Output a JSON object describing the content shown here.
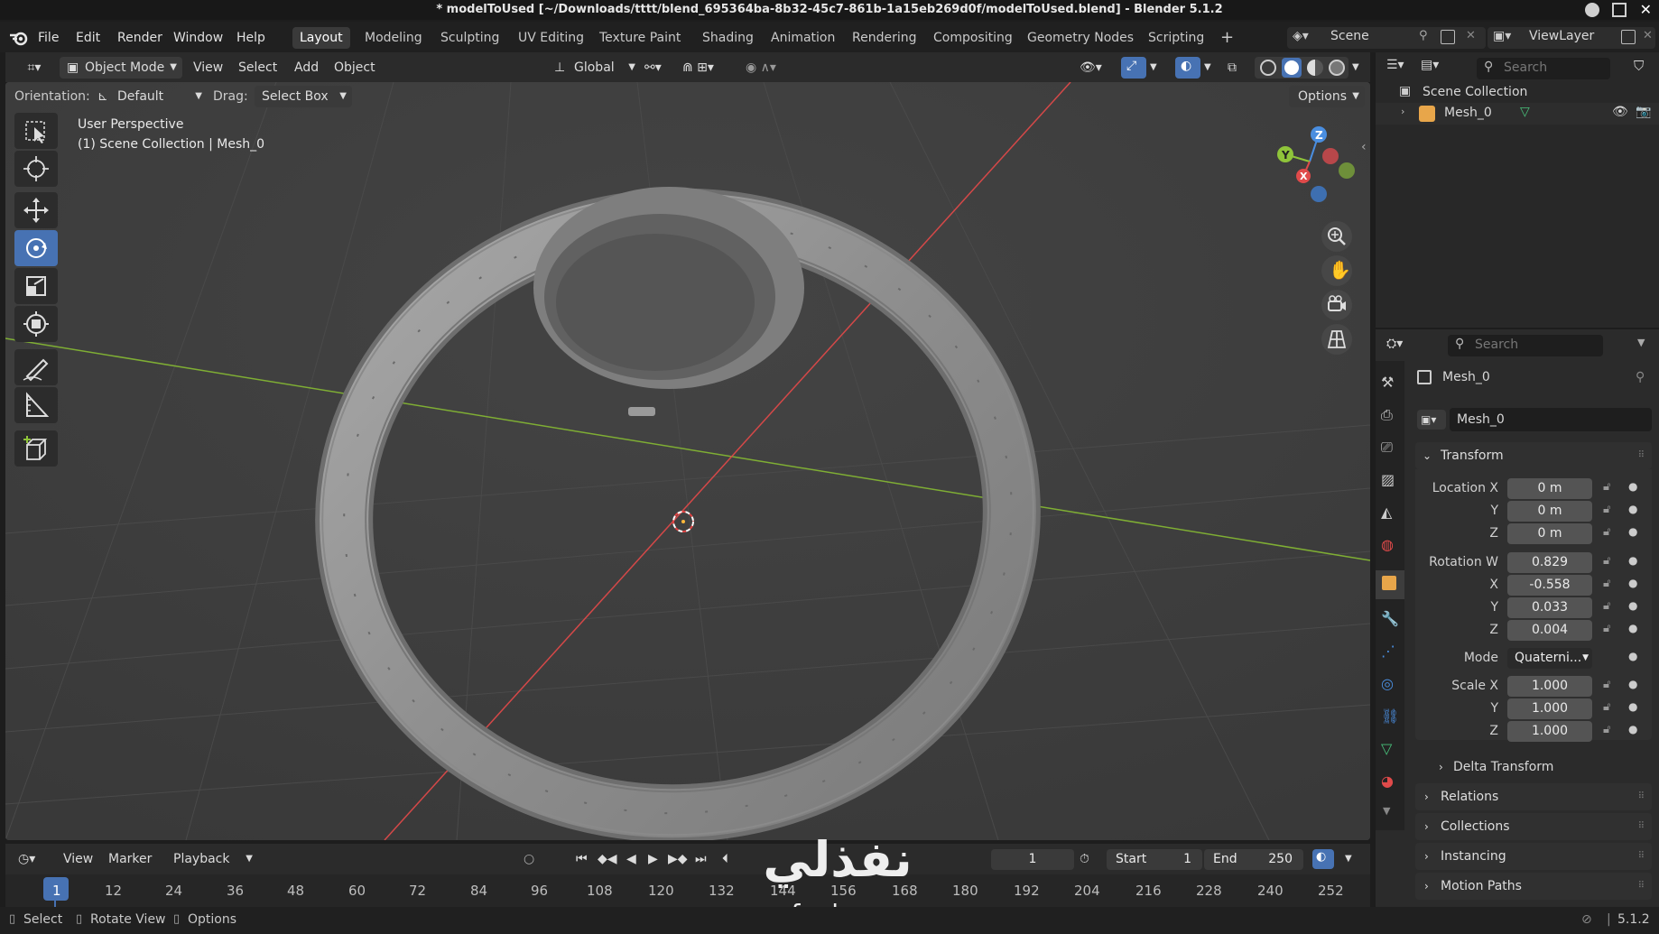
{
  "window": {
    "title": "* modelToUsed [~/Downloads/tttt/blend_695364ba-8b32-45c7-861b-1a15eb269d0f/modelToUsed.blend] - Blender 5.1.2"
  },
  "menubar": {
    "menus": [
      "File",
      "Edit",
      "Render",
      "Window",
      "Help"
    ],
    "workspaces": [
      "Layout",
      "Modeling",
      "Sculpting",
      "UV Editing",
      "Texture Paint",
      "Shading",
      "Animation",
      "Rendering",
      "Compositing",
      "Geometry Nodes",
      "Scripting"
    ],
    "active_workspace": "Layout",
    "add_workspace": "+",
    "scene": "Scene",
    "view_layer": "ViewLayer"
  },
  "viewport": {
    "mode": "Object Mode",
    "menus": [
      "View",
      "Select",
      "Add",
      "Object"
    ],
    "transform_orientation": "Global",
    "orientation_label": "Orientation:",
    "orientation_value": "Default",
    "drag_label": "Drag:",
    "drag_value": "Select Box",
    "options": "Options",
    "overlay_title": "User Perspective",
    "overlay_subtitle": "(1) Scene Collection | Mesh_0",
    "gizmo_axes": {
      "x": "X",
      "y": "Y",
      "z": "Z"
    }
  },
  "outliner": {
    "search_placeholder": "Search",
    "root": "Scene Collection",
    "items": [
      {
        "label": "Mesh_0"
      }
    ]
  },
  "properties": {
    "search_placeholder": "Search",
    "object_name": "Mesh_0",
    "data_name": "Mesh_0",
    "transform_label": "Transform",
    "location_label": "Location X",
    "location": {
      "x": "0 m",
      "y": "0 m",
      "z": "0 m"
    },
    "rotation_label": "Rotation W",
    "rotation": {
      "w": "0.829",
      "x": "-0.558",
      "y": "0.033",
      "z": "0.004"
    },
    "mode_label": "Mode",
    "mode_value": "Quaterni...",
    "scale_label": "Scale X",
    "scale": {
      "x": "1.000",
      "y": "1.000",
      "z": "1.000"
    },
    "axis_labels": {
      "x": "X",
      "y": "Y",
      "z": "Z"
    },
    "sections": [
      "Delta Transform",
      "Relations",
      "Collections",
      "Instancing",
      "Motion Paths"
    ]
  },
  "timeline": {
    "menus": [
      "View",
      "Marker",
      "Playback"
    ],
    "current_frame": "1",
    "start_label": "Start",
    "start": "1",
    "end_label": "End",
    "end": "250",
    "ruler": [
      "1",
      "12",
      "24",
      "36",
      "48",
      "60",
      "72",
      "84",
      "96",
      "108",
      "120",
      "132",
      "144",
      "156",
      "168",
      "180",
      "192",
      "204",
      "216",
      "228",
      "240",
      "252"
    ]
  },
  "statusbar": {
    "hints": [
      "Select",
      "Rotate View",
      "Options"
    ],
    "version": "5.1.2"
  },
  "watermark": {
    "arabic": "نفذلي",
    "url": "nafezly.com"
  },
  "colors": {
    "accent": "#4772b3",
    "axis_x": "#e04a4a",
    "axis_y": "#8fc43a",
    "axis_z": "#4a8ee0",
    "viewport_bg": "#3d3d3d"
  }
}
